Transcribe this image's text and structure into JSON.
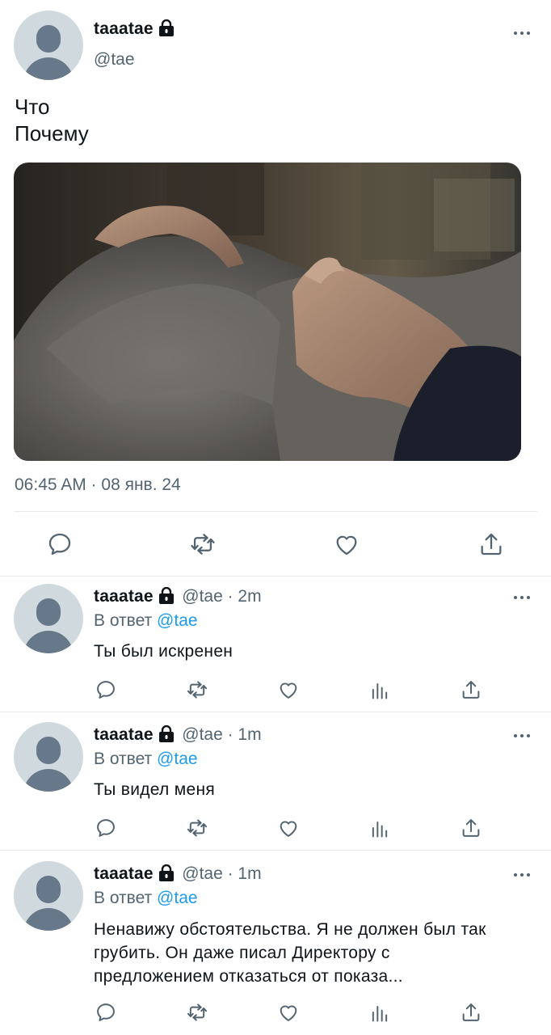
{
  "main_tweet": {
    "display_name": "taaatae",
    "handle": "@tae",
    "text_line1": "Что",
    "text_line2": "Почему",
    "timestamp": "06:45 AM · 08 янв. 24"
  },
  "replies": [
    {
      "display_name": "taaatae",
      "handle": "@tae",
      "time": " · 2m",
      "in_reply_prefix": "В ответ ",
      "in_reply_mention": "@tae",
      "text": "Ты был искренен"
    },
    {
      "display_name": "taaatae",
      "handle": "@tae",
      "time": " · 1m",
      "in_reply_prefix": "В ответ ",
      "in_reply_mention": "@tae",
      "text": "Ты видел меня"
    },
    {
      "display_name": "taaatae",
      "handle": "@tae",
      "time": " · 1m",
      "in_reply_prefix": "В ответ ",
      "in_reply_mention": "@tae",
      "text": "Ненавижу обстоятельства. Я не должен был так грубить. Он даже писал Директору с предложением отказаться от показа..."
    }
  ],
  "colors": {
    "text_primary": "#0f1419",
    "text_secondary": "#536471",
    "link": "#1d9bf0",
    "divider": "#e7e9ec"
  },
  "icons": {
    "lock": "lock-icon",
    "more": "more-icon",
    "reply": "reply-icon",
    "retweet": "retweet-icon",
    "like": "like-icon",
    "views": "views-icon",
    "share": "share-icon"
  }
}
